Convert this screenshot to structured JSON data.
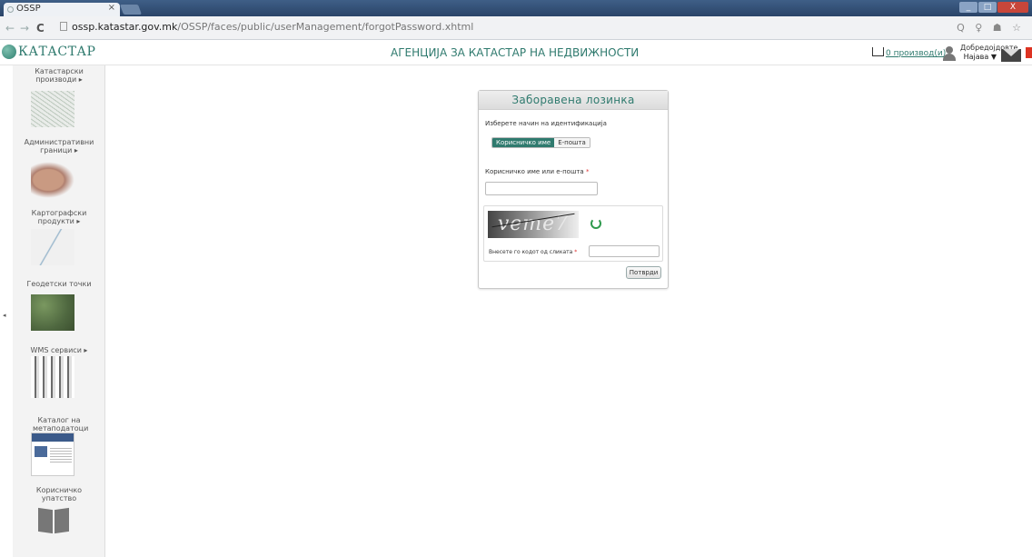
{
  "browser": {
    "tab_title": "OSSP",
    "tab_close": "×",
    "url_host": "ossp.katastar.gov.mk",
    "url_path": "/OSSP/faces/public/userManagement/forgotPassword.xhtml",
    "back": "←",
    "forward": "→",
    "reload": "C",
    "right_icons": "Q ♀ ☗ ☆",
    "win_min": "_",
    "win_max": "□",
    "win_close": "X"
  },
  "header": {
    "logo_text": "КАТАСТАР",
    "agency_title": "АГЕНЦИЈА ЗА КАТАСТАР НА НЕДВИЖНОСТИ",
    "cart_text": "0 производ(и)",
    "welcome": "Добредојдовте,",
    "login": "Најава ▼"
  },
  "sidebar": {
    "toggle": "◂",
    "items": [
      {
        "label": "Катастарски производи ▸"
      },
      {
        "label": "Административни граници ▸"
      },
      {
        "label": "Картографски продукти ▸"
      },
      {
        "label": "Геодетски точки"
      },
      {
        "label": "WMS сервиси ▸"
      },
      {
        "label": "Каталог на метаподатоци"
      },
      {
        "label": "Корисничко упатство"
      }
    ]
  },
  "form": {
    "title": "Заборавена лозинка",
    "prompt": "Изберете начин на идентификација",
    "option_username": "Корисничко име",
    "option_email": "Е-пошта",
    "field_label": "Корисничко име или е-пошта",
    "required_mark": "*",
    "field_value": "",
    "captcha_text": "veme7",
    "captcha_label": "Внесете го кодот од сликата",
    "captcha_value": "",
    "submit_label": "Потврди"
  },
  "colors": {
    "accent": "#2f7a6e",
    "required": "#dd3333"
  }
}
